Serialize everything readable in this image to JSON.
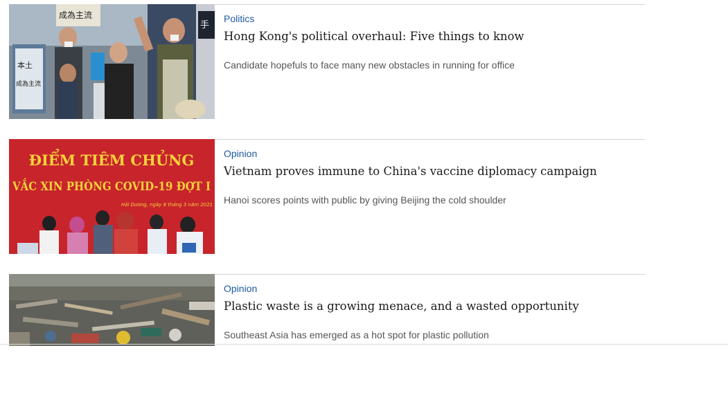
{
  "feed": {
    "articles": [
      {
        "section": "Politics",
        "headline": "Hong Kong's political overhaul: Five things to know",
        "summary": "Candidate hopefuls to face many new obstacles in running for office",
        "image": {
          "description_icon": "protest-photo",
          "sign_text_1": "成為主流",
          "sign_text_2": "本土",
          "sign_text_3": "成為主流",
          "sign_text_4": "手"
        }
      },
      {
        "section": "Opinion",
        "headline": "Vietnam proves immune to China's vaccine diplomacy campaign",
        "summary": "Hanoi scores points with public by giving Beijing the cold shoulder",
        "image": {
          "description_icon": "vaccination-event-photo",
          "banner_line_1": "ĐIỂM TIÊM CHỦNG",
          "banner_line_2": "VẮC XIN PHÒNG COVID-19 ĐỢT I",
          "banner_line_3": "Hải Dương, ngày 8 tháng 3 năm 2021"
        }
      },
      {
        "section": "Opinion",
        "headline": "Plastic waste is a growing menace, and a wasted opportunity",
        "summary": "Southeast Asia has emerged as a hot spot for plastic pollution",
        "image": {
          "description_icon": "plastic-waste-photo"
        }
      }
    ]
  },
  "colors": {
    "section_link": "#1d5aa0",
    "headline": "#1a1a1a",
    "summary": "#555555",
    "divider": "#d4d4d4",
    "banner_red": "#c8242c",
    "banner_yellow": "#f4d23a"
  }
}
